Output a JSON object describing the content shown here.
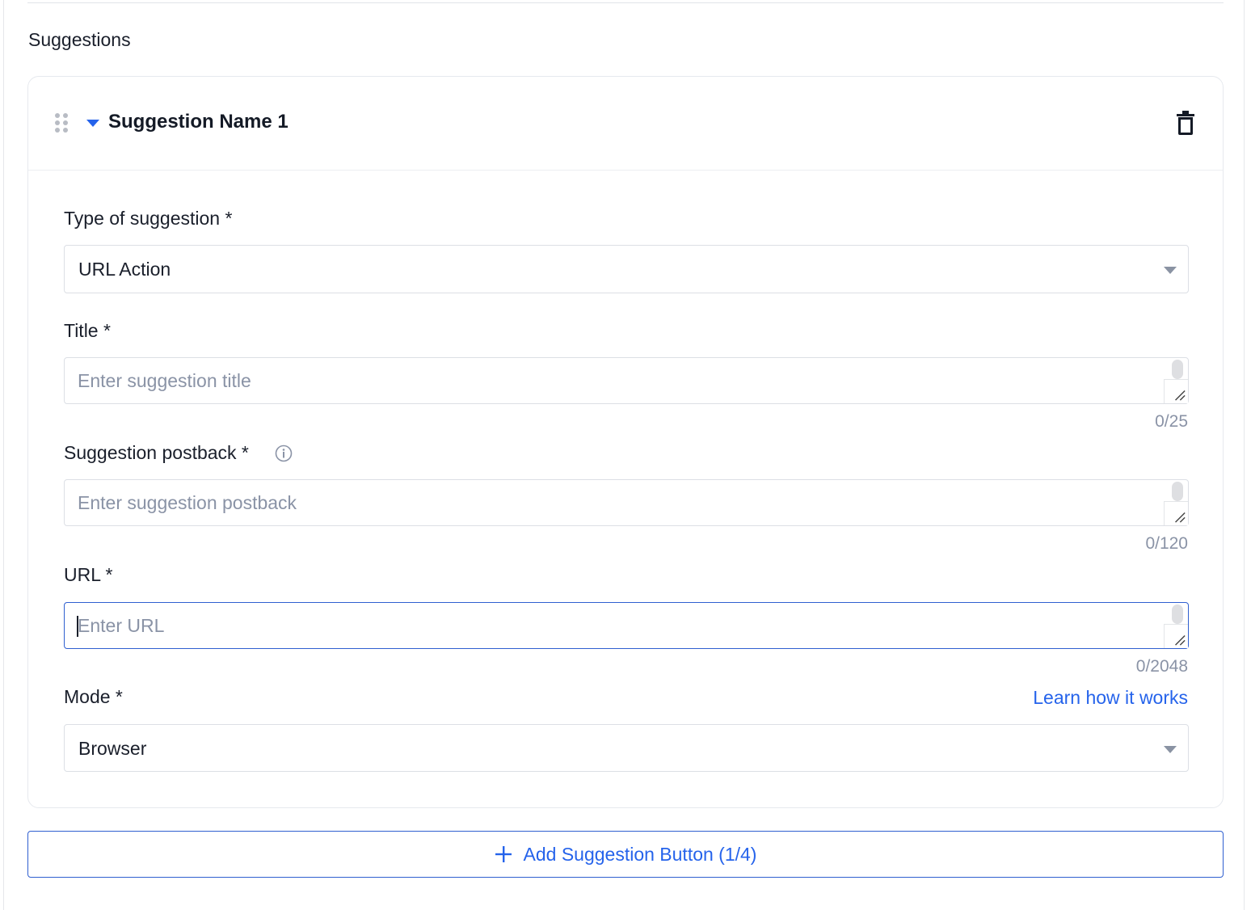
{
  "section": {
    "title": "Suggestions"
  },
  "card": {
    "title": "Suggestion Name 1",
    "fields": {
      "type": {
        "label": "Type of suggestion *",
        "value": "URL Action"
      },
      "title": {
        "label": "Title *",
        "placeholder": "Enter suggestion title",
        "counter": "0/25"
      },
      "postback": {
        "label": "Suggestion postback *",
        "placeholder": "Enter suggestion postback",
        "counter": "0/120"
      },
      "url": {
        "label": "URL *",
        "placeholder": "Enter URL",
        "counter": "0/2048"
      },
      "mode": {
        "label": "Mode *",
        "value": "Browser",
        "help_link": "Learn how it works"
      }
    }
  },
  "add_button": {
    "label": "Add Suggestion Button (1/4)"
  },
  "colors": {
    "accent": "#2563eb",
    "border": "#dcdfe5",
    "muted_text": "#8a93a6"
  },
  "icons": [
    "drag-handle-icon",
    "caret-down-icon",
    "trash-icon",
    "info-icon",
    "plus-icon"
  ]
}
